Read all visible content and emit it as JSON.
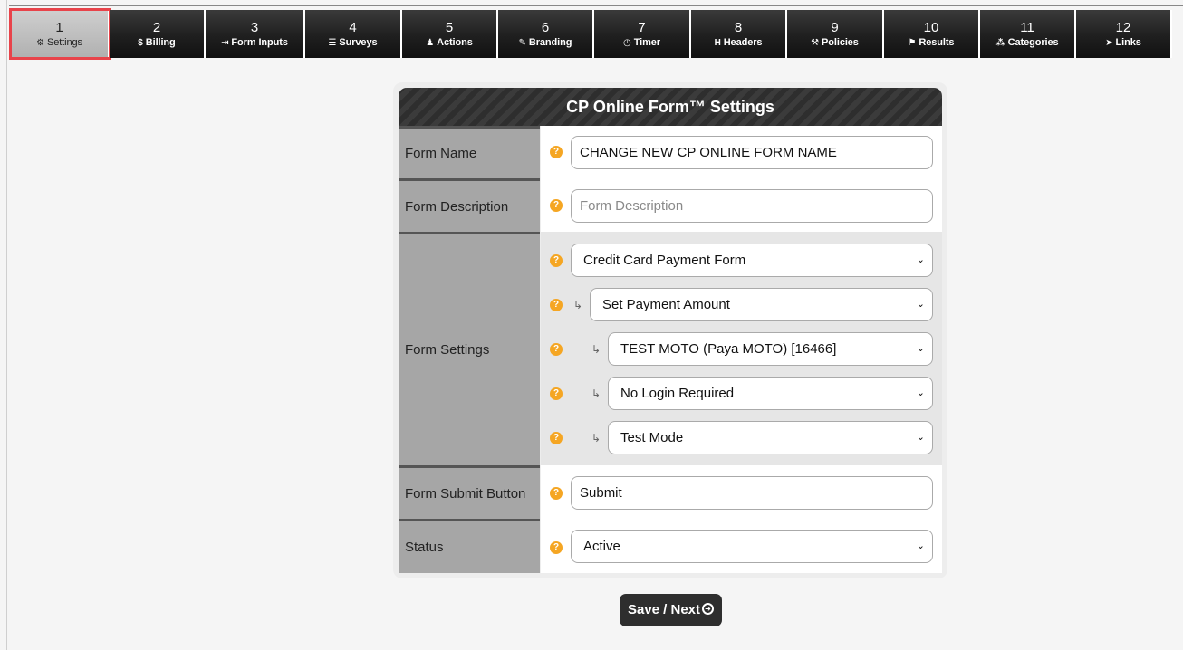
{
  "tabs": [
    {
      "num": "1",
      "label": "Settings",
      "icon": "⚙",
      "icon_name": "gear-icon",
      "active": true
    },
    {
      "num": "2",
      "label": "Billing",
      "icon": "$",
      "icon_name": "dollar-icon"
    },
    {
      "num": "3",
      "label": "Form Inputs",
      "icon": "⇥",
      "icon_name": "sign-in-icon"
    },
    {
      "num": "4",
      "label": "Surveys",
      "icon": "☰",
      "icon_name": "list-icon"
    },
    {
      "num": "5",
      "label": "Actions",
      "icon": "♟",
      "icon_name": "user-icon"
    },
    {
      "num": "6",
      "label": "Branding",
      "icon": "✎",
      "icon_name": "brush-icon"
    },
    {
      "num": "7",
      "label": "Timer",
      "icon": "◷",
      "icon_name": "clock-icon"
    },
    {
      "num": "8",
      "label": "Headers",
      "icon": "H",
      "icon_name": "header-icon"
    },
    {
      "num": "9",
      "label": "Policies",
      "icon": "⚒",
      "icon_name": "gavel-icon"
    },
    {
      "num": "10",
      "label": "Results",
      "icon": "⚑",
      "icon_name": "flag-icon"
    },
    {
      "num": "11",
      "label": "Categories",
      "icon": "⁂",
      "icon_name": "cubes-icon"
    },
    {
      "num": "12",
      "label": "Links",
      "icon": "➤",
      "icon_name": "pointer-icon"
    }
  ],
  "panel": {
    "title": "CP Online Form™ Settings"
  },
  "form": {
    "name_label": "Form Name",
    "name_value": "CHANGE NEW CP ONLINE FORM NAME",
    "description_label": "Form Description",
    "description_placeholder": "Form Description",
    "settings_label": "Form Settings",
    "form_type": "Credit Card Payment Form",
    "payment_amount": "Set Payment Amount",
    "merchant": "TEST MOTO (Paya MOTO) [16466]",
    "login": "No Login Required",
    "mode": "Test Mode",
    "submit_label": "Form Submit Button",
    "submit_value": "Submit",
    "status_label": "Status",
    "status_value": "Active"
  },
  "help_glyph": "?",
  "sub_arrow": "↳",
  "chevron": "⌄",
  "save_button": {
    "label": "Save / Next",
    "icon": "➜"
  },
  "colors": {
    "accent_help": "#f5a623",
    "active_tab_outline": "#e8434a",
    "dark": "#2e2e2e"
  }
}
